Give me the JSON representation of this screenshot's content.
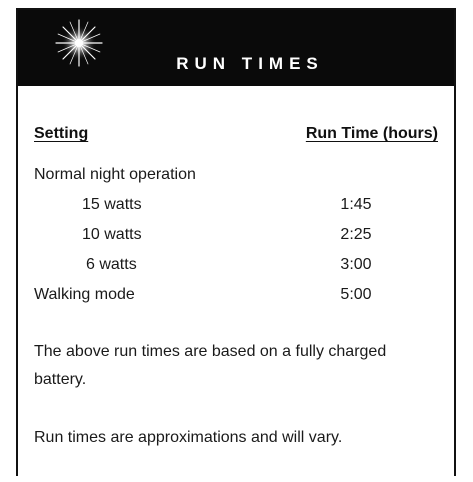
{
  "header": {
    "title": "RUN TIMES",
    "icon": "starburst-icon"
  },
  "table": {
    "columns": [
      "Setting",
      "Run Time (hours)"
    ],
    "rows": [
      {
        "setting": "Normal night operation",
        "time": ""
      },
      {
        "setting": "15 watts",
        "time": "1:45"
      },
      {
        "setting": "10 watts",
        "time": "2:25"
      },
      {
        "setting": "6 watts",
        "time": "3:00"
      },
      {
        "setting": "Walking mode",
        "time": "5:00"
      }
    ]
  },
  "notes": [
    "The above run times are based on a fully charged battery.",
    "Run times are approximations and will vary."
  ]
}
